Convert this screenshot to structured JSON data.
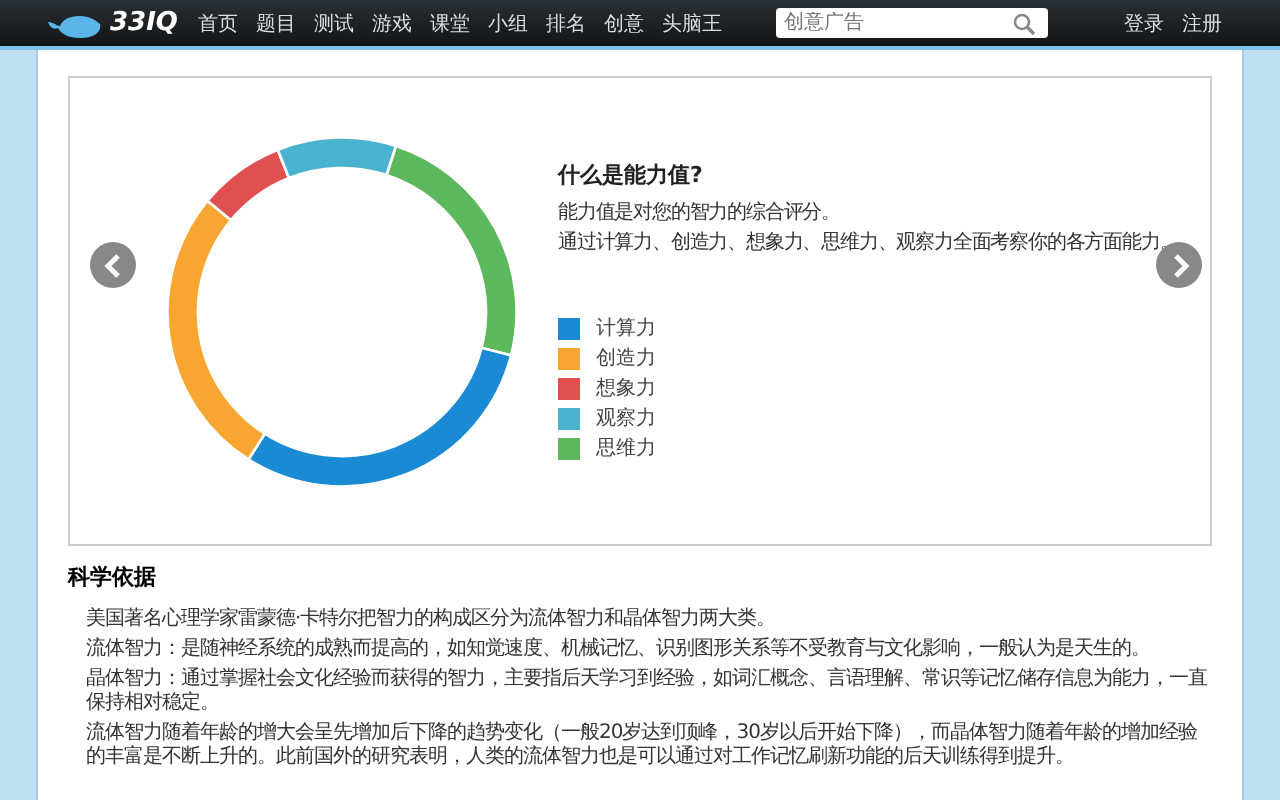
{
  "nav": {
    "logo": "33IQ",
    "links": [
      "首页",
      "题目",
      "测试",
      "游戏",
      "课堂",
      "小组",
      "排名",
      "创意",
      "头脑王"
    ],
    "search": {
      "placeholder": "创意广告"
    },
    "account": [
      "登录",
      "注册"
    ]
  },
  "slide": {
    "title": "什么是能力值?",
    "lines": [
      "能力值是对您的智力的综合评分。",
      "通过计算力、创造力、想象力、思维力、观察力全面考察你的各方面能力。"
    ],
    "legend": [
      {
        "label": "计算力",
        "color": "#1a8ad4"
      },
      {
        "label": "创造力",
        "color": "#f7a731"
      },
      {
        "label": "想象力",
        "color": "#e05050"
      },
      {
        "label": "观察力",
        "color": "#4ab3d0"
      },
      {
        "label": "思维力",
        "color": "#5cb85c"
      }
    ]
  },
  "section": {
    "title": "科学依据",
    "paragraphs": [
      "美国著名心理学家雷蒙德·卡特尔把智力的构成区分为流体智力和晶体智力两大类。",
      "流体智力：是随神经系统的成熟而提高的，如知觉速度、机械记忆、识别图形关系等不受教育与文化影响，一般认为是天生的。",
      "晶体智力：通过掌握社会文化经验而获得的智力，主要指后天学习到经验，如词汇概念、言语理解、常识等记忆储存信息为能力，一直保持相对稳定。",
      "流体智力随着年龄的增大会呈先增加后下降的趋势变化（一般20岁达到顶峰，30岁以后开始下降），而晶体智力随着年龄的增加经验的丰富是不断上升的。此前国外的研究表明，人类的流体智力也是可以通过对工作记忆刷新功能的后天训练得到提升。"
    ]
  }
}
